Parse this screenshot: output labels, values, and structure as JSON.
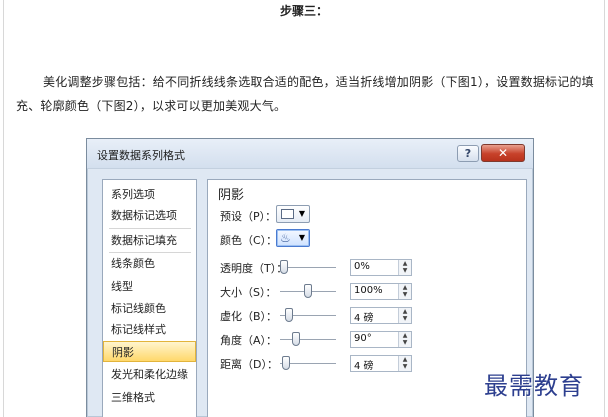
{
  "article": {
    "step_title": "步骤三：",
    "paragraph": "美化调整步骤包括：给不同折线线条选取合适的配色，适当折线增加阴影（下图1），设置数据标记的填充、轮廓颜色（下图2），以求可以更加美观大气。"
  },
  "dialog": {
    "title": "设置数据系列格式",
    "help_label": "?",
    "close_label": "✕",
    "nav_items": [
      {
        "label": "系列选项",
        "selected": false
      },
      {
        "label": "数据标记选项",
        "selected": false
      },
      {
        "label": "数据标记填充",
        "selected": false
      },
      {
        "label": "线条颜色",
        "selected": false
      },
      {
        "label": "线型",
        "selected": false
      },
      {
        "label": "标记线颜色",
        "selected": false
      },
      {
        "label": "标记线样式",
        "selected": false
      },
      {
        "label": "阴影",
        "selected": true
      },
      {
        "label": "发光和柔化边缘",
        "selected": false
      },
      {
        "label": "三维格式",
        "selected": false
      }
    ],
    "panel": {
      "section_title": "阴影",
      "preset_label": "预设（P）：",
      "color_label": "颜色（C）：",
      "transparency_label": "透明度（T）：",
      "transparency_value": "0%",
      "transparency_level": 0,
      "size_label": "大小（S）：",
      "size_value": "100%",
      "size_level": 0.5,
      "blur_label": "虚化（B）：",
      "blur_value": "4 磅",
      "blur_level": 0.1,
      "angle_label": "角度（A）：",
      "angle_value": "90°",
      "angle_level": 0.25,
      "distance_label": "距离（D）：",
      "distance_value": "4 磅",
      "distance_level": 0.05
    },
    "icons": {
      "preset": "shadow-preset-icon",
      "color": "paint-bucket-icon",
      "dropdown": "chevron-down-icon",
      "spin_up": "spin-up-icon",
      "spin_down": "spin-down-icon"
    }
  },
  "watermark": "最需教育"
}
